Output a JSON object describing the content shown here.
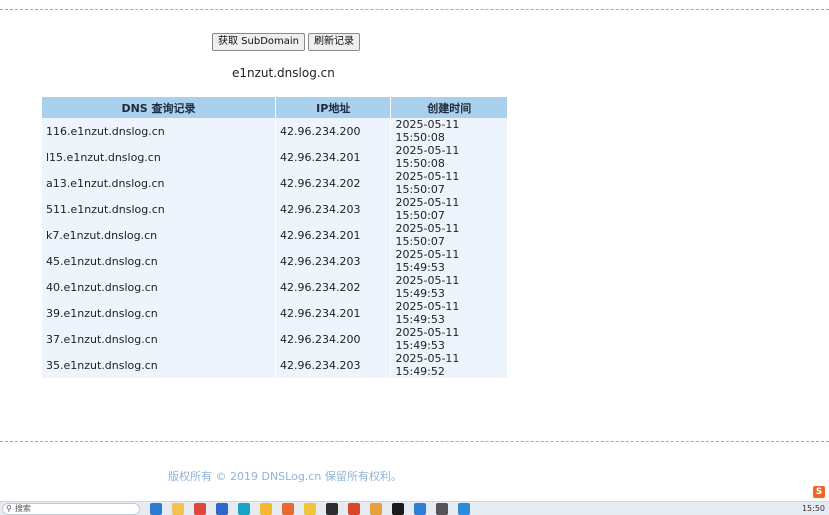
{
  "buttons": {
    "get_subdomain": "获取 SubDomain",
    "refresh": "刷新记录"
  },
  "domain": "e1nzut.dnslog.cn",
  "table": {
    "headers": [
      "DNS 查询记录",
      "IP地址",
      "创建时间"
    ],
    "rows": [
      [
        "116.e1nzut.dnslog.cn",
        "42.96.234.200",
        "2025-05-11 15:50:08"
      ],
      [
        "l15.e1nzut.dnslog.cn",
        "42.96.234.201",
        "2025-05-11 15:50:08"
      ],
      [
        "a13.e1nzut.dnslog.cn",
        "42.96.234.202",
        "2025-05-11 15:50:07"
      ],
      [
        "511.e1nzut.dnslog.cn",
        "42.96.234.203",
        "2025-05-11 15:50:07"
      ],
      [
        "k7.e1nzut.dnslog.cn",
        "42.96.234.201",
        "2025-05-11 15:50:07"
      ],
      [
        "45.e1nzut.dnslog.cn",
        "42.96.234.203",
        "2025-05-11 15:49:53"
      ],
      [
        "40.e1nzut.dnslog.cn",
        "42.96.234.202",
        "2025-05-11 15:49:53"
      ],
      [
        "39.e1nzut.dnslog.cn",
        "42.96.234.201",
        "2025-05-11 15:49:53"
      ],
      [
        "37.e1nzut.dnslog.cn",
        "42.96.234.200",
        "2025-05-11 15:49:53"
      ],
      [
        "35.e1nzut.dnslog.cn",
        "42.96.234.203",
        "2025-05-11 15:49:52"
      ]
    ]
  },
  "footer": "版权所有 © 2019 DNSLog.cn 保留所有权利。",
  "side_badge": "S",
  "taskbar": {
    "search_placeholder": "搜索",
    "clock": "15:50",
    "app_icons": [
      {
        "name": "edge-icon",
        "color": "#2b7bd6"
      },
      {
        "name": "file-explorer-icon",
        "color": "#f2c14e"
      },
      {
        "name": "chrome-icon",
        "color": "#e0453a"
      },
      {
        "name": "store-icon",
        "color": "#2f68c9"
      },
      {
        "name": "browser-icon",
        "color": "#17a4c7"
      },
      {
        "name": "folder-icon",
        "color": "#f5b82e"
      },
      {
        "name": "mail-icon",
        "color": "#e86a2e"
      },
      {
        "name": "notes-icon",
        "color": "#f0c43a"
      },
      {
        "name": "terminal-icon",
        "color": "#2d2d2d"
      },
      {
        "name": "office-icon",
        "color": "#d9472b"
      },
      {
        "name": "photo-icon",
        "color": "#e8a13a"
      },
      {
        "name": "pycharm-icon",
        "color": "#1b1b1b"
      },
      {
        "name": "app-icon",
        "color": "#2e7fd8"
      },
      {
        "name": "avatar-icon",
        "color": "#555555"
      },
      {
        "name": "vscode-icon",
        "color": "#2a8ae0"
      }
    ]
  }
}
